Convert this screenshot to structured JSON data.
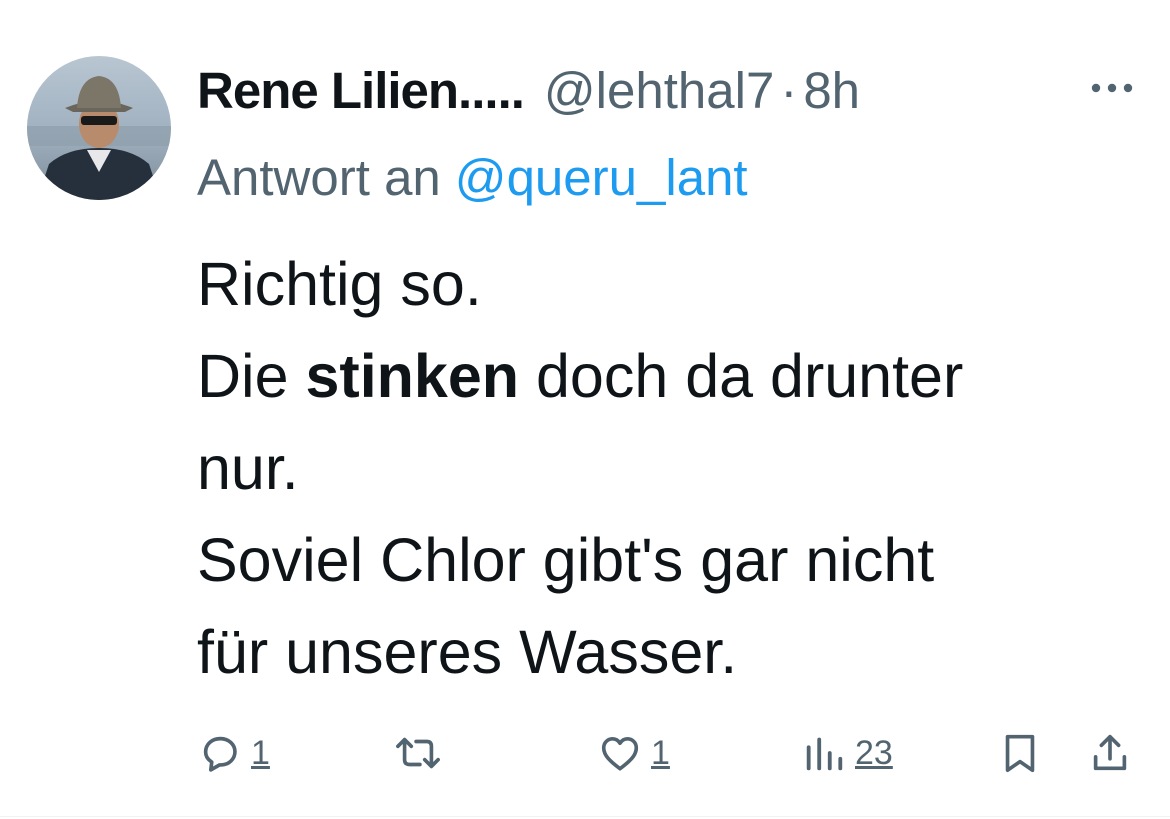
{
  "tweet": {
    "author_name": "Rene Lilien.....",
    "handle": "@lehthal7",
    "separator": "·",
    "time": "8h",
    "reply_prefix": "Antwort an",
    "reply_mention": "@queru_lant",
    "body_lines": {
      "l1": "Richtig so.",
      "l2_pre": "Die ",
      "l2_bold": "stinken",
      "l2_post": " doch da drunter",
      "l3": "nur.",
      "l4": "Soviel Chlor gibt's gar nicht",
      "l5": "für unseres Wasser."
    },
    "actions": {
      "reply_count": "1",
      "like_count": "1",
      "views_count": "23"
    }
  },
  "icons": {
    "more": "more-horizontal-icon",
    "reply": "reply-bubble-icon",
    "retweet": "retweet-icon",
    "like": "heart-icon",
    "views": "bar-chart-icon",
    "bookmark": "bookmark-icon",
    "share": "share-icon"
  },
  "colors": {
    "text_primary": "#0f1419",
    "text_secondary": "#536471",
    "link": "#1d9bf0"
  }
}
